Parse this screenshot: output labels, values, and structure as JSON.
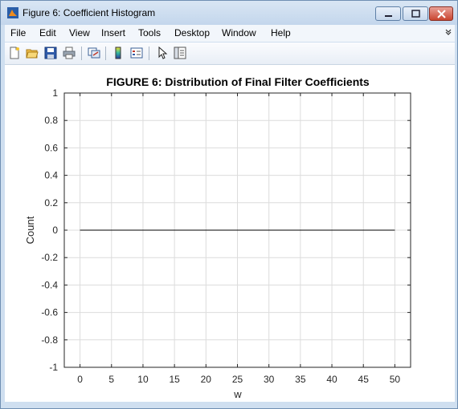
{
  "window": {
    "title": "Figure 6: Coefficient Histogram",
    "icon": "matlab-figure-icon"
  },
  "menu": [
    "File",
    "Edit",
    "View",
    "Insert",
    "Tools",
    "Desktop",
    "Window",
    "Help"
  ],
  "toolbar": [
    "new-figure-icon",
    "open-file-icon",
    "save-icon",
    "print-icon",
    "link-plot-icon",
    "insert-colorbar-icon",
    "insert-legend-icon",
    "edit-plot-pointer-icon",
    "property-inspector-icon"
  ],
  "chart_data": {
    "type": "line",
    "title": "FIGURE 6: Distribution of Final Filter Coefficients",
    "xlabel": "w",
    "ylabel": "Count",
    "xlim": [
      -2.5,
      52.5
    ],
    "ylim": [
      -1,
      1
    ],
    "x_ticks": [
      "0",
      "5",
      "10",
      "15",
      "20",
      "25",
      "30",
      "35",
      "40",
      "45",
      "50"
    ],
    "y_ticks": [
      "1",
      "0.8",
      "0.6",
      "0.4",
      "0.2",
      "0",
      "-0.2",
      "-0.4",
      "-0.6",
      "-0.8",
      "-1"
    ],
    "grid": true,
    "series": [
      {
        "x": [
          0,
          50
        ],
        "y": [
          0,
          0
        ],
        "color": "#000000"
      }
    ]
  }
}
